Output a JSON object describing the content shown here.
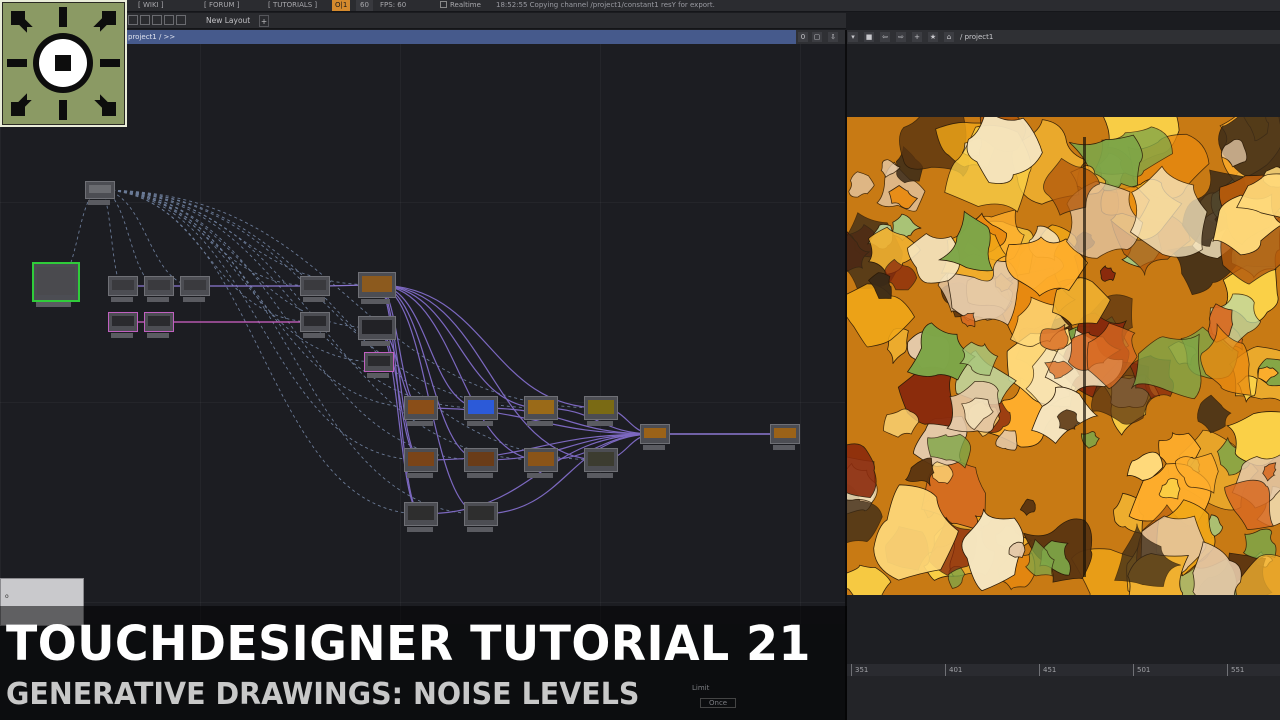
{
  "toolbar": {
    "wiki": "[ WIKI ]",
    "forum": "[ FORUM ]",
    "tutorials": "[ TUTORIALS ]",
    "perf_badge": "O|1",
    "fps_target": "60",
    "fps": "FPS: 60",
    "realtime": "Realtime",
    "status_message": "18:52:55 Copying channel /project1/constant1 resY for export."
  },
  "layout_bar": {
    "tab_label": "New Layout",
    "add_label": "+"
  },
  "network": {
    "path": "project1 / >>",
    "node_count": 30
  },
  "viewer": {
    "path": "/ project1",
    "buttons": [
      "0",
      "▢",
      "⇩",
      "▾",
      "■",
      "⇦",
      "⇨",
      "+",
      "★",
      "⌂"
    ]
  },
  "timeline": {
    "ticks": [
      "351",
      "401",
      "451",
      "501",
      "551"
    ]
  },
  "bottom_controls": {
    "limit": "Limit",
    "once": "Once"
  },
  "colors": {
    "path_bar": "#465a8c",
    "accent_orange": "#d58a2d",
    "wire_purple": "#8c78d2",
    "wire_pink": "#d262c8",
    "logo_green": "#8b9a64"
  },
  "overlay": {
    "title": "TOUCHDESIGNER TUTORIAL 21",
    "subtitle": "GENERATIVE DRAWINGS: NOISE LEVELS"
  }
}
